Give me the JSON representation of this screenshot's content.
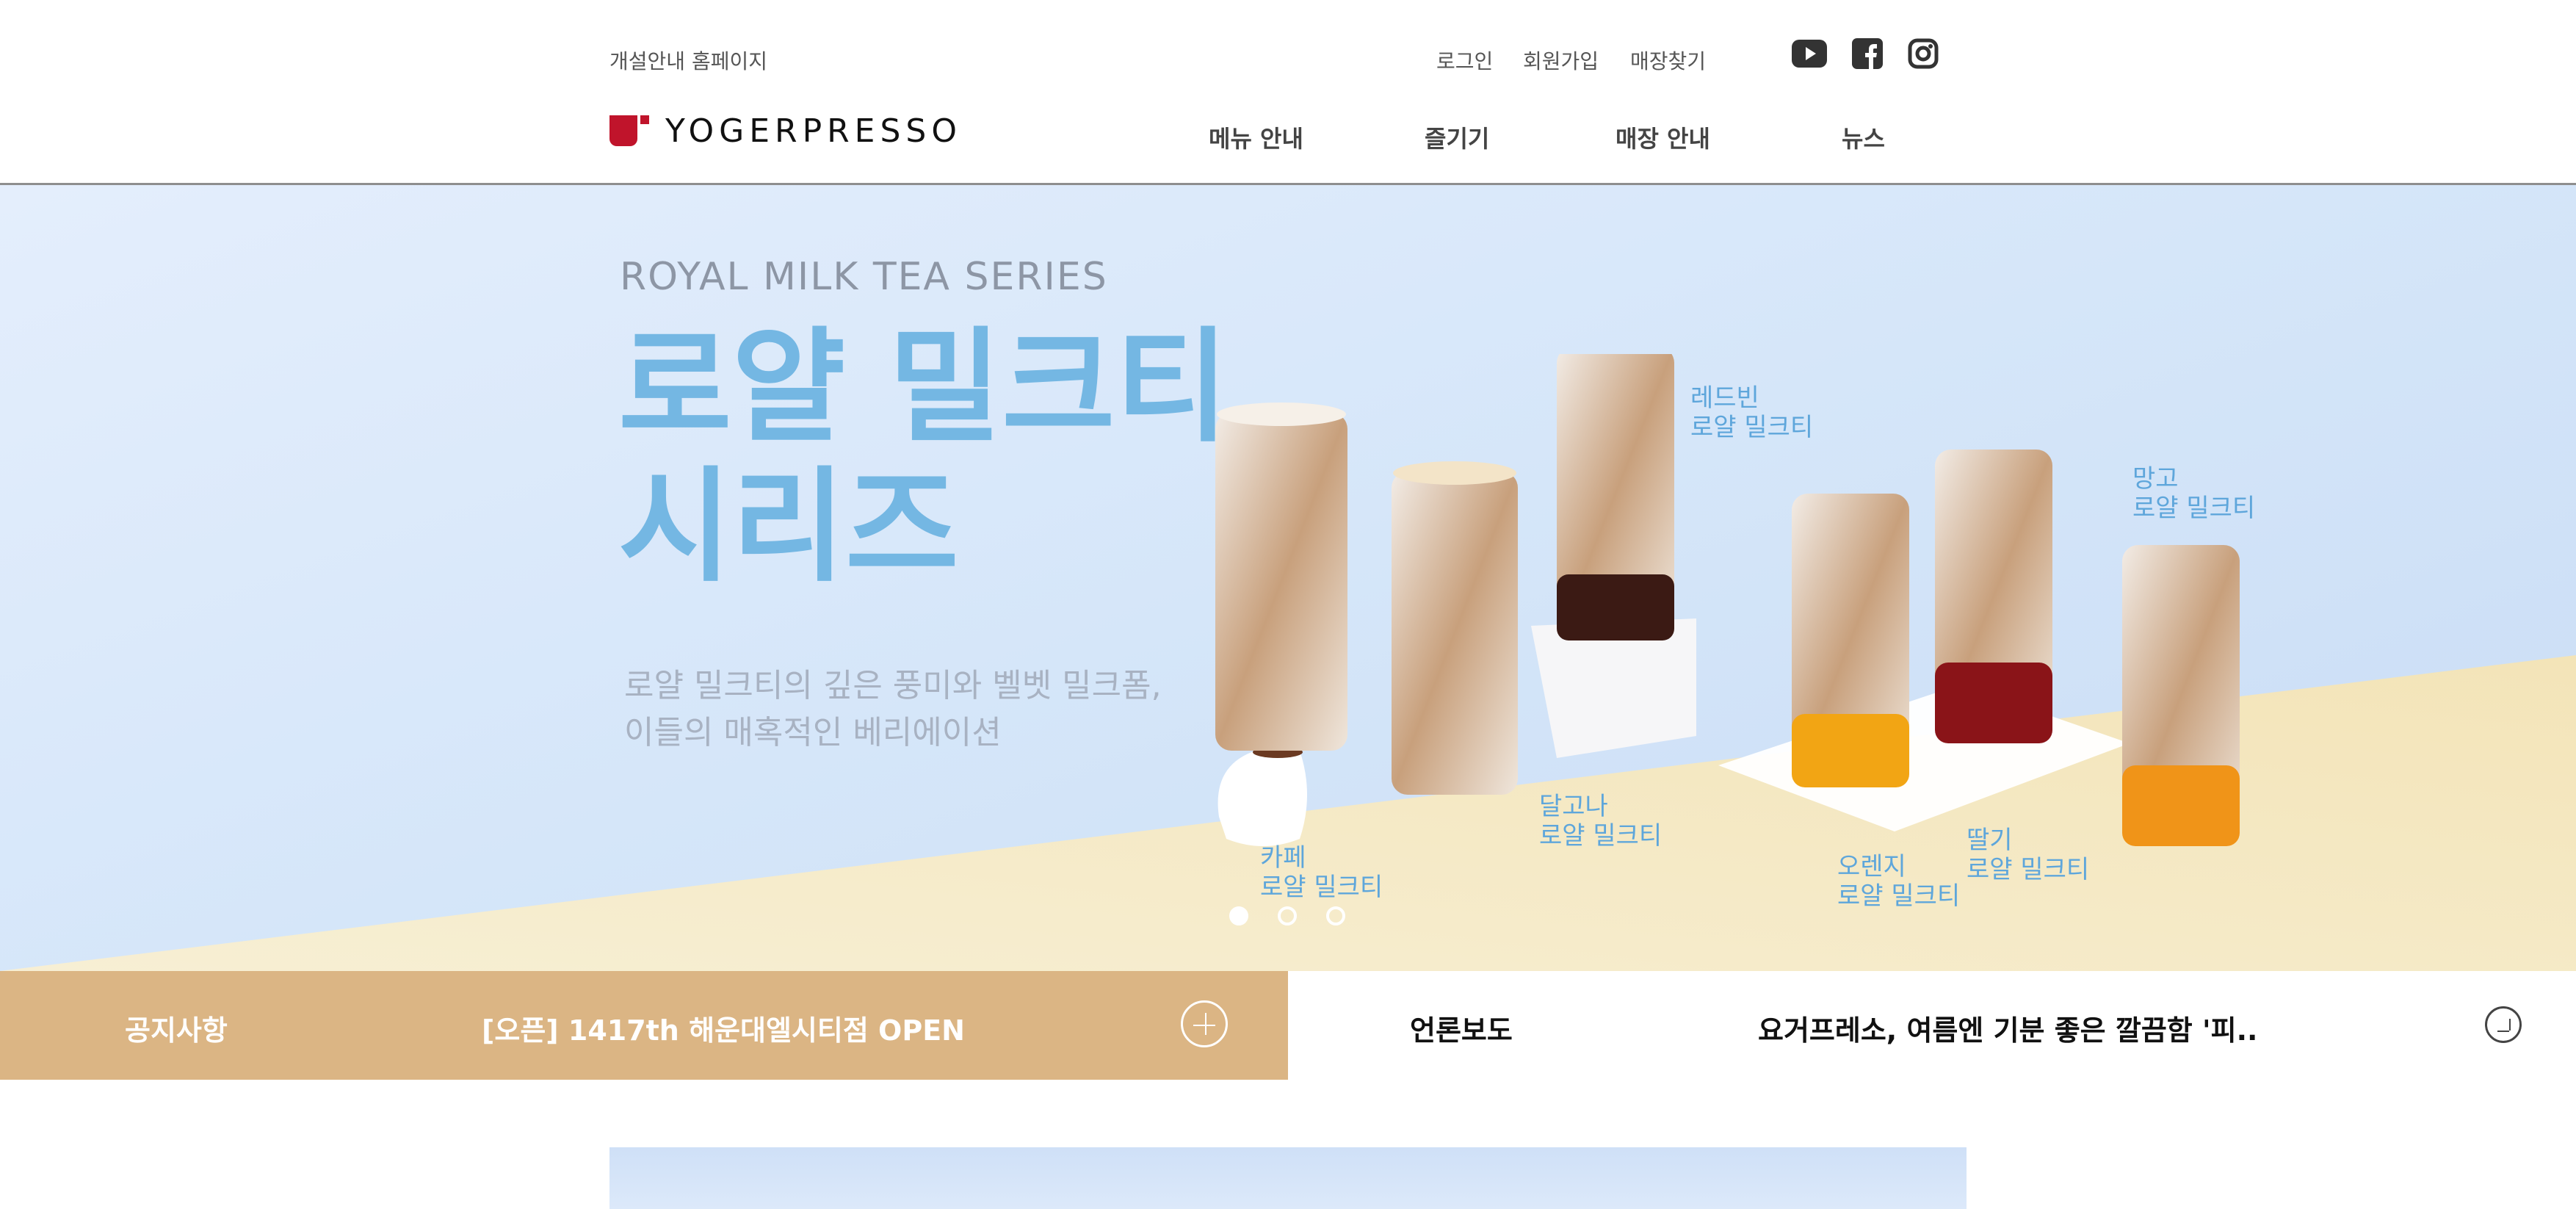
{
  "header": {
    "open_guide": "개설안내 홈페이지",
    "login": "로그인",
    "signup": "회원가입",
    "store_finder": "매장찾기",
    "logo_text": "YOGERPRESSO",
    "nav": [
      "메뉴 안내",
      "즐기기",
      "매장 안내",
      "뉴스"
    ],
    "sns_icons": [
      "youtube-icon",
      "facebook-icon",
      "instagram-icon"
    ]
  },
  "hero": {
    "subtitle": "ROYAL MILK TEA SERIES",
    "title_line1": "로얄 밀크티",
    "title_line2": "시리즈",
    "desc_line1": "로얄 밀크티의 깊은 풍미와 벨벳 밀크폼,",
    "desc_line2": "이들의 매혹적인 베리에이션",
    "labels": {
      "cafe": [
        "카페",
        "로얄 밀크티"
      ],
      "dalgona": [
        "달고나",
        "로얄 밀크티"
      ],
      "redbean": [
        "레드빈",
        "로얄 밀크티"
      ],
      "orange": [
        "오렌지",
        "로얄 밀크티"
      ],
      "strawberry": [
        "딸기",
        "로얄 밀크티"
      ],
      "mango": [
        "망고",
        "로얄 밀크티"
      ]
    },
    "slider": {
      "total": 3,
      "active": 1
    },
    "colors": {
      "title": "#74b7e3",
      "label": "#5ea6db"
    }
  },
  "notice": {
    "label": "공지사항",
    "headline": "[오픈] 1417th 해운대엘시티점 OPEN",
    "color": "#dbb584"
  },
  "press": {
    "label": "언론보도",
    "headline": "요거프레소, 여름엔 기분 좋은 깔끔함 '피.."
  }
}
